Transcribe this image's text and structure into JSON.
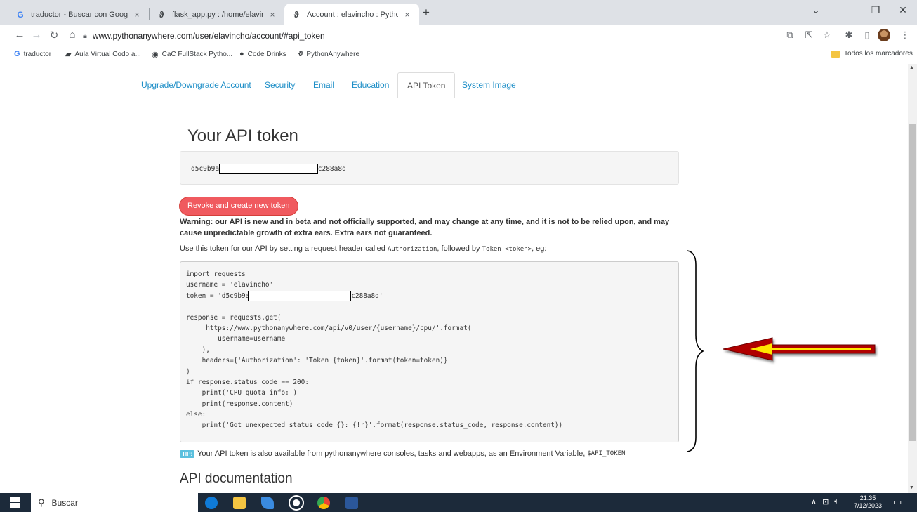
{
  "browser": {
    "tabs": [
      {
        "favicon": "G",
        "favicon_color": "#4285f4",
        "title": "traductor - Buscar con Google",
        "close": "×"
      },
      {
        "favicon": "ϑ",
        "favicon_color": "#555555",
        "title": "flask_app.py : /home/elavincho/",
        "close": "×"
      },
      {
        "favicon": "ϑ",
        "favicon_color": "#555555",
        "title": "Account : elavincho : PythonAny",
        "close": "×"
      }
    ],
    "new_tab": "+",
    "window_controls": {
      "tab_search": "⌄",
      "minimize": "—",
      "restore": "❐",
      "close": "✕"
    },
    "url": "www.pythonanywhere.com/user/elavincho/account/#api_token",
    "bookmarks": [
      {
        "icon": "G",
        "label": "traductor"
      },
      {
        "icon": "▰",
        "label": "Aula Virtual Codo a..."
      },
      {
        "icon": "◉",
        "label": "CaC FullStack Pytho..."
      },
      {
        "icon": "●",
        "label": "Code Drinks"
      },
      {
        "icon": "ϑ",
        "label": "PythonAnywhere"
      }
    ],
    "all_bookmarks": "Todos los marcadores"
  },
  "page": {
    "tabs": [
      {
        "label": "Upgrade/Downgrade Account"
      },
      {
        "label": "Security"
      },
      {
        "label": "Email"
      },
      {
        "label": "Education"
      },
      {
        "label": "API Token"
      },
      {
        "label": "System Image"
      }
    ],
    "active_tab": "API Token",
    "token_heading": "Your API token",
    "token_prefix": "d5c9b9a6",
    "token_suffix": "c288a8d",
    "revoke_label": "Revoke and create new token",
    "warning": "Warning: our API is new and in beta and not officially supported, and may change at any time, and it is not to be relied upon, and may cause unpredictable growth of extra ears. Extra ears not guaranteed.",
    "usage_before": "Use this token for our API by setting a request header called ",
    "usage_code1": "Authorization",
    "usage_middle": ", followed by ",
    "usage_code2": "Token <token>",
    "usage_after": ", eg:",
    "code_lines": [
      "import requests",
      "username = 'elavincho'",
      "token = 'd5c9b9a",
      "",
      "response = requests.get(",
      "    'https://www.pythonanywhere.com/api/v0/user/{username}/cpu/'.format(",
      "        username=username",
      "    ),",
      "    headers={'Authorization': 'Token {token}'.format(token=token)}",
      ")",
      "if response.status_code == 200:",
      "    print('CPU quota info:')",
      "    print(response.content)",
      "else:",
      "    print('Got unexpected status code {}: {!r}'.format(response.status_code, response.content))"
    ],
    "code_token_suffix": "c288a8d'",
    "tip_badge": "TIP:",
    "tip_text": "Your API token is also available from pythonanywhere consoles, tasks and webapps, as an Environment Variable,",
    "tip_env": "$API_TOKEN",
    "api_doc_heading": "API documentation"
  },
  "taskbar": {
    "search_placeholder": "Buscar",
    "time": "21:35",
    "date": "7/12/2023"
  },
  "colors": {
    "link": "#1d8ec7",
    "revoke": "#f05a5f",
    "arrow_fill": "#b00000",
    "arrow_stripe": "#ffe600"
  }
}
